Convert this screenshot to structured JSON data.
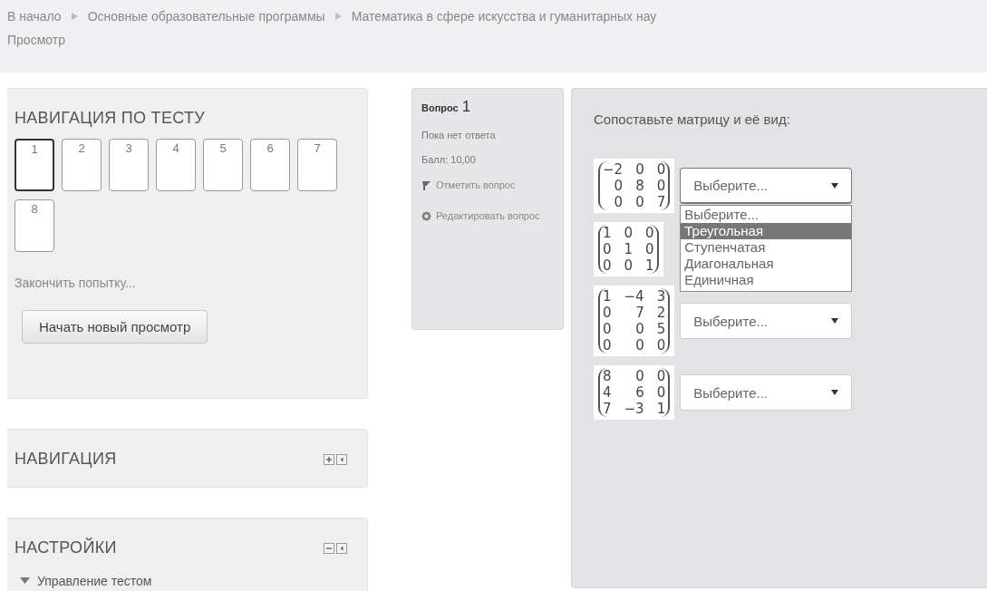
{
  "breadcrumb": {
    "items": [
      "В начало",
      "Основные образовательные программы",
      "Математика в сфере искусства и гуманитарных нау"
    ],
    "current": "Просмотр"
  },
  "quiz_nav": {
    "title": "НАВИГАЦИЯ ПО ТЕСТУ",
    "buttons": [
      {
        "label": "1",
        "selected": true
      },
      {
        "label": "2",
        "selected": false
      },
      {
        "label": "3",
        "selected": false
      },
      {
        "label": "4",
        "selected": false
      },
      {
        "label": "5",
        "selected": false
      },
      {
        "label": "6",
        "selected": false
      },
      {
        "label": "7",
        "selected": false
      },
      {
        "label": "8",
        "selected": false
      }
    ],
    "finish_link": "Закончить попытку...",
    "new_preview_button": "Начать новый просмотр"
  },
  "blocks": [
    {
      "title": "НАВИГАЦИЯ",
      "expanded": false
    },
    {
      "title": "НАСТРОЙКИ",
      "expanded": true,
      "tree": [
        {
          "label": "Управление тестом",
          "expanded": true
        }
      ]
    }
  ],
  "question_info": {
    "label": "Вопрос",
    "number": "1",
    "state": "Пока нет ответа",
    "grade": "Балл: 10,00",
    "flag_link": "Отметить вопрос",
    "edit_link": "Редактировать вопрос"
  },
  "question": {
    "text": "Сопоставьте матрицу и её вид:",
    "items": [
      {
        "matrix": [
          [
            "−2",
            "0",
            "0"
          ],
          [
            "0",
            "8",
            "0"
          ],
          [
            "0",
            "0",
            "7"
          ]
        ],
        "select": {
          "value": "Выберите...",
          "open": true,
          "options": [
            {
              "label": "Выберите...",
              "highlighted": false
            },
            {
              "label": "Треугольная",
              "highlighted": true
            },
            {
              "label": "Ступенчатая",
              "highlighted": false
            },
            {
              "label": "Диагональная",
              "highlighted": false
            },
            {
              "label": "Единичная",
              "highlighted": false
            }
          ]
        }
      },
      {
        "matrix": [
          [
            "1",
            "0",
            "0"
          ],
          [
            "0",
            "1",
            "0"
          ],
          [
            "0",
            "0",
            "1"
          ]
        ]
      },
      {
        "matrix": [
          [
            "1",
            "−4",
            "3"
          ],
          [
            "0",
            "7",
            "2"
          ],
          [
            "0",
            "0",
            "5"
          ],
          [
            "0",
            "0",
            "0"
          ]
        ],
        "select": {
          "value": "Выберите...",
          "open": false
        }
      },
      {
        "matrix": [
          [
            "8",
            "0",
            "0"
          ],
          [
            "4",
            "6",
            "0"
          ],
          [
            "7",
            "−3",
            "1"
          ]
        ],
        "select": {
          "value": "Выберите...",
          "open": false
        }
      }
    ]
  }
}
